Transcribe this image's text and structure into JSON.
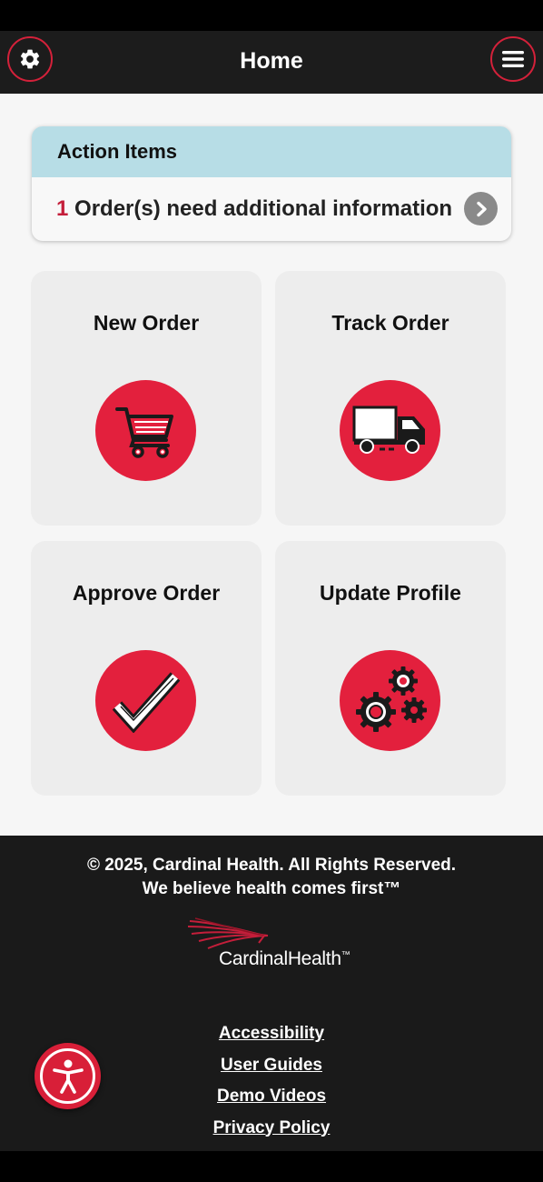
{
  "header": {
    "title": "Home",
    "settings_icon": "gear-icon",
    "menu_icon": "hamburger-menu-icon"
  },
  "action_items": {
    "title": "Action Items",
    "count": "1",
    "message": "Order(s) need additional information",
    "arrow_icon": "chevron-right-icon"
  },
  "tiles": [
    {
      "label": "New Order",
      "icon": "shopping-cart-icon"
    },
    {
      "label": "Track Order",
      "icon": "delivery-truck-icon"
    },
    {
      "label": "Approve Order",
      "icon": "checkmark-icon"
    },
    {
      "label": "Update Profile",
      "icon": "gears-icon"
    }
  ],
  "footer": {
    "copyright": "© 2025, Cardinal Health. All Rights Reserved.",
    "tagline": "We believe health comes first™",
    "logo_text_bold": "Cardinal",
    "logo_text_light": "Health",
    "logo_tm": "™",
    "links": [
      "Accessibility",
      "User Guides",
      "Demo Videos",
      "Privacy Policy"
    ]
  },
  "accessibility_button": {
    "icon": "accessibility-person-icon"
  },
  "colors": {
    "brand_red": "#e3203d",
    "header_bg": "#1c1c1c",
    "action_header_bg": "#b7dde6",
    "tile_bg": "#ededed"
  }
}
